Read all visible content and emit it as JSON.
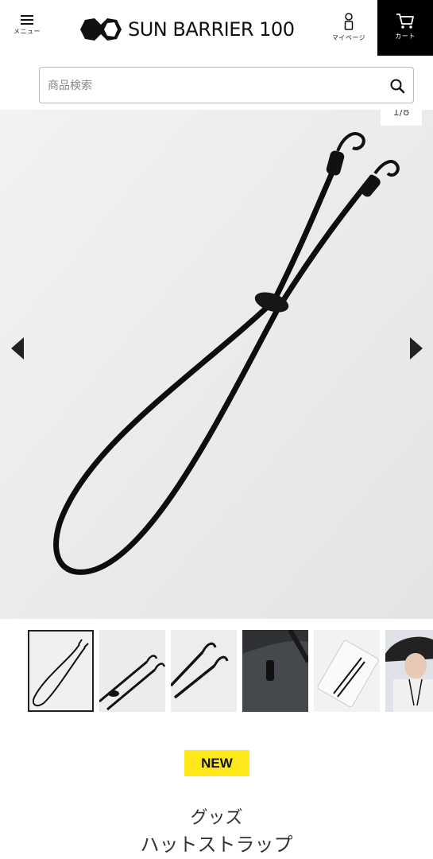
{
  "header": {
    "menu_label": "メニュー",
    "logo_text": "SUN BARRIER 100",
    "mypage_label": "マイページ",
    "cart_label": "カート"
  },
  "search": {
    "placeholder": "商品検索"
  },
  "gallery": {
    "counter": "1/8",
    "thumbnails": [
      "thumbnail-1",
      "thumbnail-2",
      "thumbnail-3",
      "thumbnail-4",
      "thumbnail-5",
      "thumbnail-6"
    ]
  },
  "product": {
    "badge": "NEW",
    "category": "グッズ",
    "name": "ハットストラップ"
  },
  "colors": {
    "cart_background": "#000000",
    "badge_background": "#ffe81a",
    "image_background": "#ececec"
  }
}
